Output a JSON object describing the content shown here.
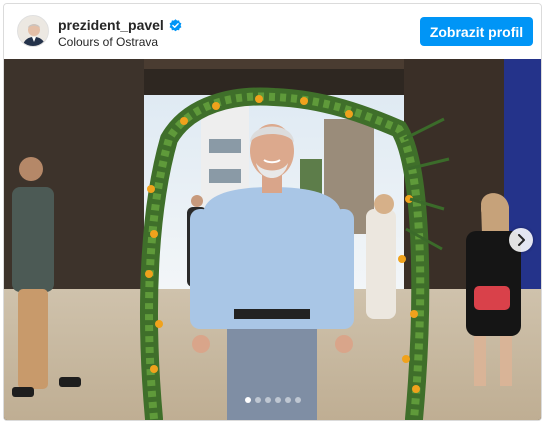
{
  "post": {
    "username": "prezident_pavel",
    "location": "Colours of Ostrava",
    "profile_button_label": "Zobrazit profil",
    "verified_icon": "verified-badge-icon",
    "next_icon": "chevron-right-icon",
    "carousel": {
      "total": 6,
      "current": 1
    }
  },
  "colors": {
    "accent": "#0095f6",
    "verified": "#0095f6",
    "text": "#262626"
  }
}
